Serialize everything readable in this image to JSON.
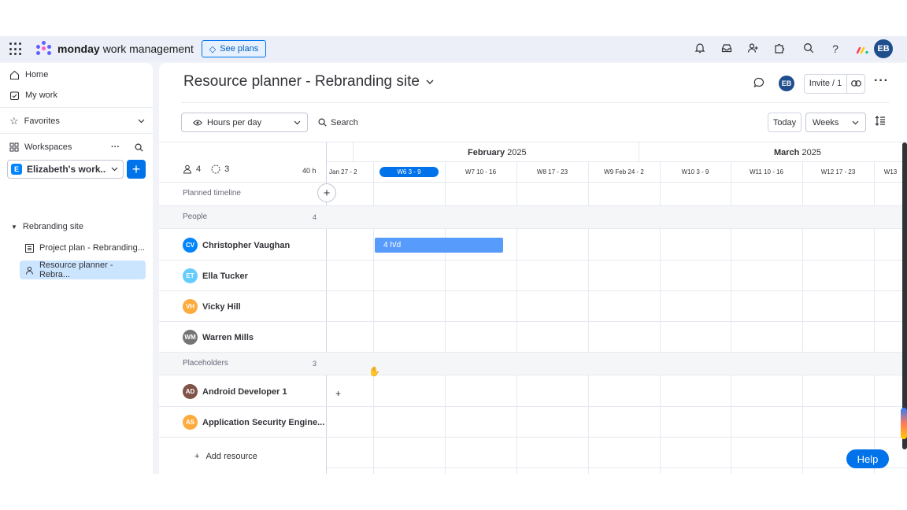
{
  "topbar": {
    "brand_bold": "monday",
    "brand_rest": "work management",
    "see_plans": "See plans",
    "user_initials": "EB"
  },
  "sidebar": {
    "home": "Home",
    "my_work": "My work",
    "favorites": "Favorites",
    "workspaces": "Workspaces",
    "workspace_badge": "E",
    "workspace_name": "Elizabeth's work...",
    "folder": "Rebranding site",
    "items": [
      {
        "label": "Project plan - Rebranding..."
      },
      {
        "label": "Resource planner - Rebra..."
      }
    ]
  },
  "board": {
    "title": "Resource planner - Rebranding site",
    "owner_initials": "EB",
    "invite_label": "Invite / 1",
    "view_select": "Hours per day",
    "search_label": "Search",
    "today_label": "Today",
    "scale_select": "Weeks"
  },
  "timeline": {
    "people_count": "4",
    "placeholder_count": "3",
    "hours": "40 h",
    "planned_timeline": "Planned timeline",
    "months": [
      {
        "name": "February",
        "year": "2025"
      },
      {
        "name": "March",
        "year": "2025"
      }
    ],
    "weeks": [
      "Jan 27 - 2",
      "W6 3 - 9",
      "W7 10 - 16",
      "W8 17 - 23",
      "W9 Feb 24 - 2",
      "W10 3 - 9",
      "W11 10 - 16",
      "W12 17 - 23",
      "W13"
    ],
    "current_week": "W6 3 - 9",
    "sections": {
      "people": {
        "label": "People",
        "count": "4"
      },
      "placeholders": {
        "label": "Placeholders",
        "count": "3"
      }
    },
    "people": [
      {
        "initials": "CV",
        "name": "Christopher Vaughan",
        "color": "#0085ff"
      },
      {
        "initials": "ET",
        "name": "Ella Tucker",
        "color": "#66ccff"
      },
      {
        "initials": "VH",
        "name": "Vicky Hill",
        "color": "#fdab3d"
      },
      {
        "initials": "WM",
        "name": "Warren Mills",
        "color": "#757575"
      }
    ],
    "placeholders": [
      {
        "initials": "AD",
        "name": "Android Developer 1",
        "color": "#7f5347"
      },
      {
        "initials": "AS",
        "name": "Application Security Engine...",
        "color": "#fdab3d"
      }
    ],
    "booking_label": "4 h/d",
    "add_resource": "Add resource"
  },
  "help_label": "Help"
}
